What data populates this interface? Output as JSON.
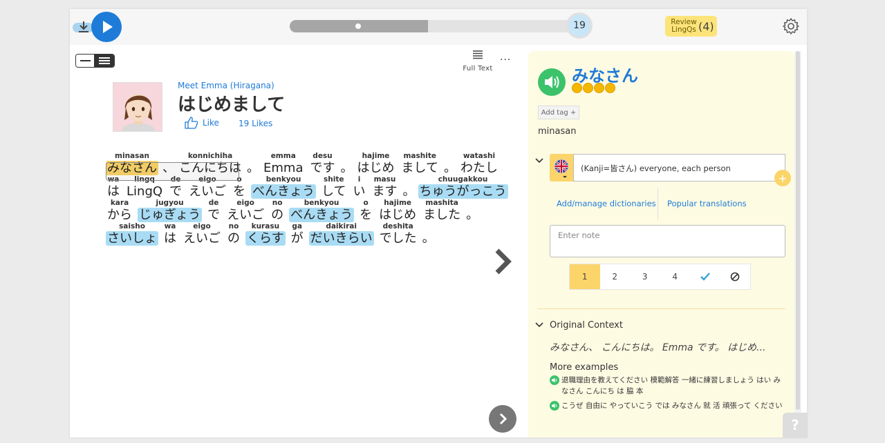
{
  "topbar": {
    "current_page": "19",
    "progress_fraction": 0.49,
    "review_label": "Review LingQs",
    "review_count": "(4)"
  },
  "reader": {
    "full_text_label": "Full Text",
    "more_label": "···",
    "course_title": "Meet Emma (Hiragana)",
    "lesson_title": "はじめまして",
    "like_label": "Like",
    "likes_count": "19 Likes",
    "lines": [
      [
        {
          "r": "minasan",
          "t": "みなさん",
          "s": "sel"
        },
        {
          "p": "、"
        },
        {
          "r": "konnichiha",
          "t": "こんにちは",
          "s": "known"
        },
        {
          "p": "。"
        },
        {
          "r": "emma",
          "t": "Emma",
          "s": "known"
        },
        {
          "r": "desu",
          "t": "です",
          "s": "known"
        },
        {
          "p": "。"
        },
        {
          "r": "hajime",
          "t": "はじめ",
          "s": "known"
        },
        {
          "r": "mashite",
          "t": "まして",
          "s": "known"
        },
        {
          "p": "。"
        },
        {
          "r": "watashi",
          "t": "わたし",
          "s": "known"
        }
      ],
      [
        {
          "r": "wa",
          "t": "は",
          "s": "known"
        },
        {
          "r": "lingq",
          "t": "LingQ",
          "s": "known"
        },
        {
          "r": "de",
          "t": "で",
          "s": "known"
        },
        {
          "r": "eigo",
          "t": "えいご",
          "s": "known"
        },
        {
          "r": "o",
          "t": "を",
          "s": "known"
        },
        {
          "r": "benkyou",
          "t": "べんきょう",
          "s": "new"
        },
        {
          "r": "shite",
          "t": "して",
          "s": "known"
        },
        {
          "r": "i",
          "t": "い",
          "s": "known"
        },
        {
          "r": "masu",
          "t": "ます",
          "s": "known"
        },
        {
          "p": "。"
        },
        {
          "r": "chuugakkou",
          "t": "ちゅうがっこう",
          "s": "new"
        }
      ],
      [
        {
          "r": "kara",
          "t": "から",
          "s": "known"
        },
        {
          "r": "jugyou",
          "t": "じゅぎょう",
          "s": "new"
        },
        {
          "r": "de",
          "t": "で",
          "s": "known"
        },
        {
          "r": "eigo",
          "t": "えいご",
          "s": "known"
        },
        {
          "r": "no",
          "t": "の",
          "s": "known"
        },
        {
          "r": "benkyou",
          "t": "べんきょう",
          "s": "new"
        },
        {
          "r": "o",
          "t": "を",
          "s": "known"
        },
        {
          "r": "hajime",
          "t": "はじめ",
          "s": "known"
        },
        {
          "r": "mashita",
          "t": "ました",
          "s": "known"
        },
        {
          "p": "。"
        }
      ],
      [
        {
          "r": "saisho",
          "t": "さいしょ",
          "s": "new"
        },
        {
          "r": "wa",
          "t": "は",
          "s": "known"
        },
        {
          "r": "eigo",
          "t": "えいご",
          "s": "known"
        },
        {
          "r": "no",
          "t": "の",
          "s": "known"
        },
        {
          "r": "kurasu",
          "t": "くらす",
          "s": "new"
        },
        {
          "r": "ga",
          "t": "が",
          "s": "known"
        },
        {
          "r": "daikirai",
          "t": "だいきらい",
          "s": "new"
        },
        {
          "r": "deshita",
          "t": "でした",
          "s": "known"
        },
        {
          "p": "。"
        }
      ]
    ]
  },
  "panel": {
    "term": "みなさん",
    "status_dots": 4,
    "add_tag_label": "Add tag +",
    "romaji": "minasan",
    "hint": "(Kanji=皆さん) everyone, each person",
    "hint_plus": "+",
    "dict_link": "Add/manage dictionaries",
    "popular_link": "Popular translations",
    "note_placeholder": "Enter note",
    "status_buttons": [
      "1",
      "2",
      "3",
      "4"
    ],
    "original_context_title": "Original Context",
    "original_context_text": "みなさん、 こんにちは。 Emma です。 はじめ...",
    "more_examples_title": "More examples",
    "examples": [
      "退職理由を教えてください 模範解答 一緒に練習しましょう はい み なさん こんにち は 脇 本",
      "こうぜ 自由に やっていこう では みなさん 就 活 頑張って ください"
    ]
  },
  "help_label": "?",
  "colors": {
    "accent": "#1e7bd8",
    "new_word": "#a9dcf4",
    "selected_word": "#fbd56a",
    "panel_bg": "#fefbe3",
    "speaker": "#3cc26b"
  }
}
